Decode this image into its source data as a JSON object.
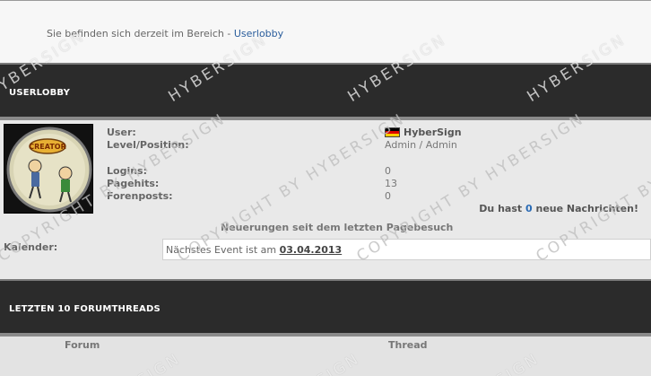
{
  "breadcrumb": {
    "prefix": "Sie befinden sich derzeit im Bereich -",
    "current": "Userlobby"
  },
  "userlobby": {
    "title": "USERLOBBY",
    "labels": {
      "user": "User:",
      "level": "Level/Position:",
      "logins": "Logins:",
      "pagehits": "Pagehits:",
      "forenposts": "Forenposts:"
    },
    "values": {
      "user": "HyberSign",
      "level": "Admin / Admin",
      "logins": "0",
      "pagehits": "13",
      "forenposts": "0"
    },
    "messages": {
      "prefix": "Du hast",
      "count": "0",
      "suffix": "neue Nachrichten!"
    },
    "news_title": "Neuerungen seit dem letzten Pagebesuch",
    "calendar": {
      "label": "Kalender:",
      "text": "Nächstes Event ist am",
      "date": "03.04.2013"
    },
    "avatar_caption": "CREATOR"
  },
  "threads": {
    "title": "LETZTEN 10 FORUMTHREADS",
    "col_forum": "Forum",
    "col_thread": "Thread"
  },
  "watermark": {
    "copyright": "COPYRIGHT BY HYBERSIGN",
    "sign": "HYBERSIGN",
    "sign_short": "SIGN"
  }
}
